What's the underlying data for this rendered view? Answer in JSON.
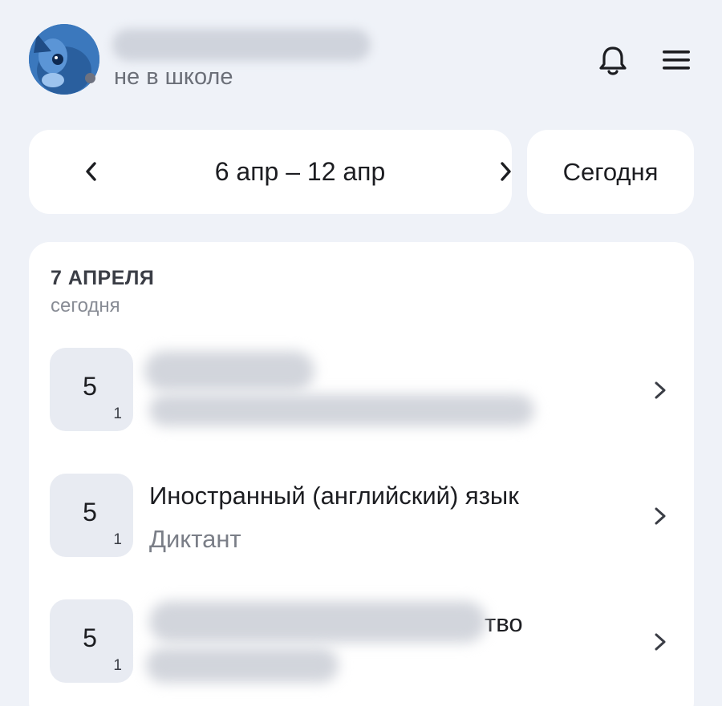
{
  "user": {
    "status": "не в школе",
    "status_color": "#6e7280"
  },
  "header_icons": {
    "notifications": "bell-icon",
    "menu": "hamburger-menu-icon"
  },
  "week_nav": {
    "range": "6 апр – 12 апр",
    "today_label": "Сегодня"
  },
  "day": {
    "title": "7 АПРЕЛЯ",
    "subtitle": "сегодня"
  },
  "grades": [
    {
      "value": "5",
      "weight": "1",
      "subject": "",
      "work": ""
    },
    {
      "value": "5",
      "weight": "1",
      "subject": "Иностранный (английский) язык",
      "work": "Диктант"
    },
    {
      "value": "5",
      "weight": "1",
      "subject_fragment": "тво",
      "work": ""
    }
  ],
  "colors": {
    "background": "#eff2f8",
    "card": "#ffffff",
    "grade_box": "#e8ebf2",
    "muted_text": "#7a7e87"
  }
}
